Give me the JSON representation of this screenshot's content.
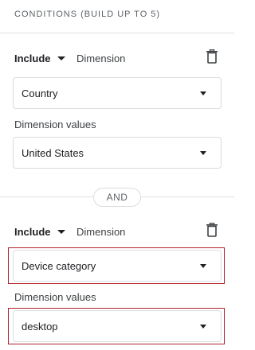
{
  "header": {
    "title": "CONDITIONS (BUILD UP TO 5)"
  },
  "conditions": [
    {
      "mode": "Include",
      "field_label": "Dimension",
      "dimension": "Country",
      "values_label": "Dimension values",
      "value": "United States"
    },
    {
      "mode": "Include",
      "field_label": "Dimension",
      "dimension": "Device category",
      "values_label": "Dimension values",
      "value": "desktop"
    }
  ],
  "connector": {
    "label": "AND"
  },
  "icons": {
    "delete": "trash-icon",
    "dropdown": "caret-down-icon"
  },
  "colors": {
    "highlight": "#b0202a"
  }
}
